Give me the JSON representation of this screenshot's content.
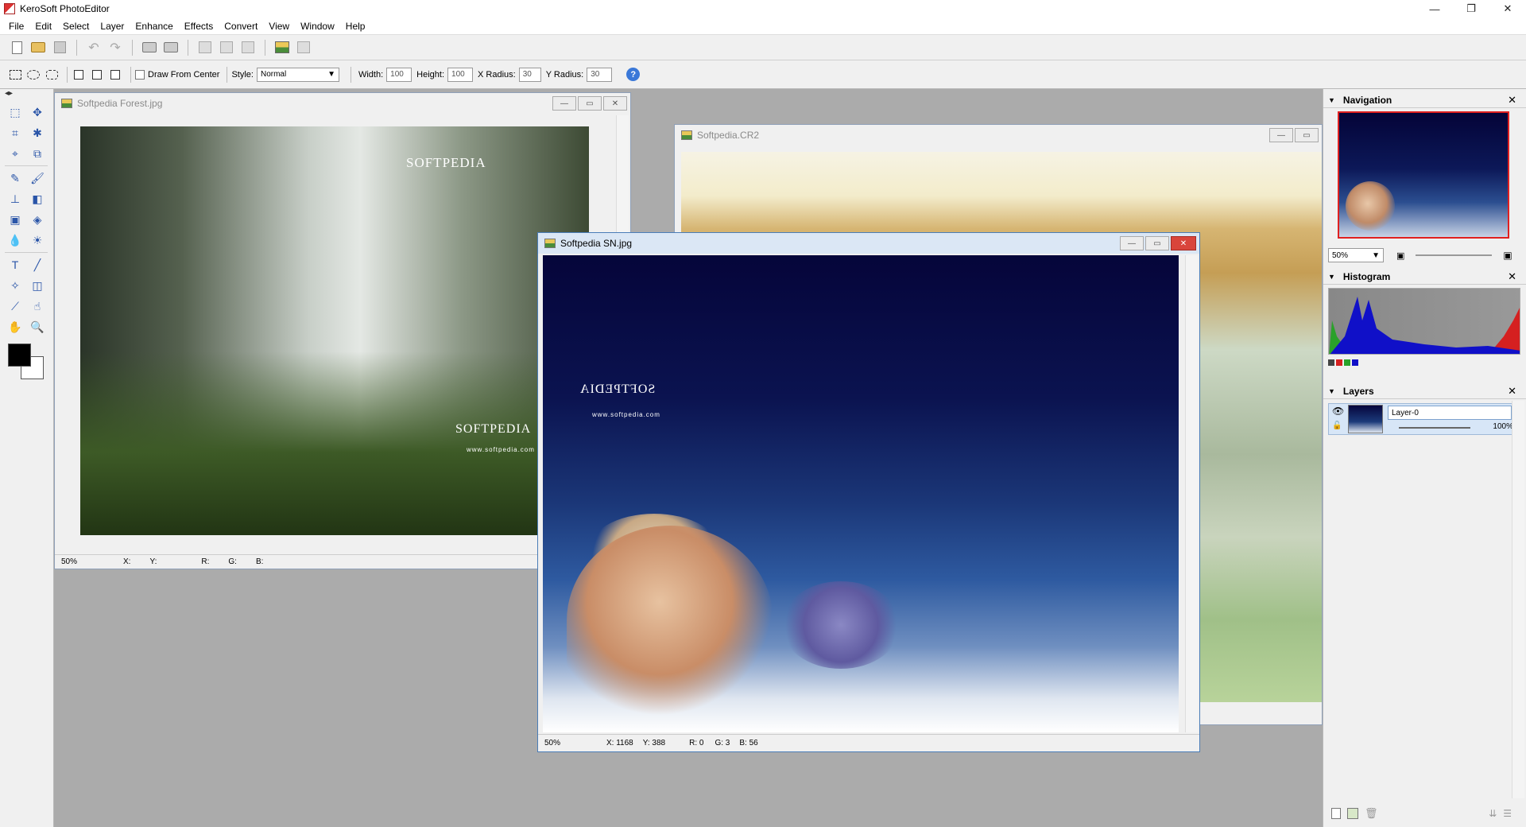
{
  "app": {
    "title": "KeroSoft PhotoEditor",
    "window_controls": [
      "—",
      "❐",
      "✕"
    ]
  },
  "menu": [
    "File",
    "Edit",
    "Select",
    "Layer",
    "Enhance",
    "Effects",
    "Convert",
    "View",
    "Window",
    "Help"
  ],
  "options": {
    "draw_from_center": "Draw From Center",
    "style_label": "Style:",
    "style_value": "Normal",
    "width_label": "Width:",
    "width_value": "100",
    "height_label": "Height:",
    "height_value": "100",
    "xradius_label": "X Radius:",
    "xradius_value": "30",
    "yradius_label": "Y Radius:",
    "yradius_value": "30",
    "help": "?"
  },
  "docs": {
    "forest": {
      "title": "Softpedia Forest.jpg",
      "zoom": "50%",
      "x": "X:",
      "y": "Y:",
      "r": "R:",
      "g": "G:",
      "b": "B:",
      "watermark": "SOFTPEDIA",
      "url": "www.softpedia.com"
    },
    "cr2": {
      "title": "Softpedia.CR2"
    },
    "sn": {
      "title": "Softpedia SN.jpg",
      "zoom": "50%",
      "x": "X: 1168",
      "y": "Y: 388",
      "r": "R: 0",
      "g": "G: 3",
      "b": "B: 56",
      "watermark": "SOFTPEDIA",
      "url": "www.softpedia.com"
    }
  },
  "panels": {
    "navigation": {
      "title": "Navigation",
      "zoom": "50%"
    },
    "histogram": {
      "title": "Histogram"
    },
    "layers": {
      "title": "Layers",
      "layer_name": "Layer-0",
      "opacity": "100%"
    }
  },
  "colors": {
    "accent": "#3a78d8",
    "close_red": "#d9453b",
    "workspace": "#ababab",
    "nav_frame": "#e02020"
  }
}
